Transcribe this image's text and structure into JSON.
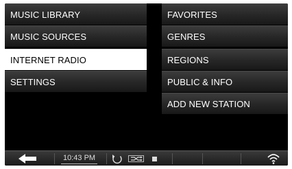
{
  "left_menu": [
    {
      "label": "MUSIC LIBRARY"
    },
    {
      "label": "MUSIC SOURCES"
    },
    {
      "label": "INTERNET RADIO",
      "selected": true
    },
    {
      "label": "SETTINGS"
    }
  ],
  "right_menu": [
    {
      "label": "FAVORITES"
    },
    {
      "label": "GENRES"
    },
    {
      "label": "REGIONS"
    },
    {
      "label": "PUBLIC & INFO"
    },
    {
      "label": "ADD NEW STATION"
    }
  ],
  "status_bar": {
    "time": "10:43 PM",
    "icons": [
      "back-arrow-icon",
      "repeat-icon",
      "shuffle-icon",
      "stop-icon",
      "wifi-icon"
    ]
  },
  "colors": {
    "background": "#000000",
    "selected_bg": "#ffffff",
    "menu_text": "#ffffff"
  }
}
